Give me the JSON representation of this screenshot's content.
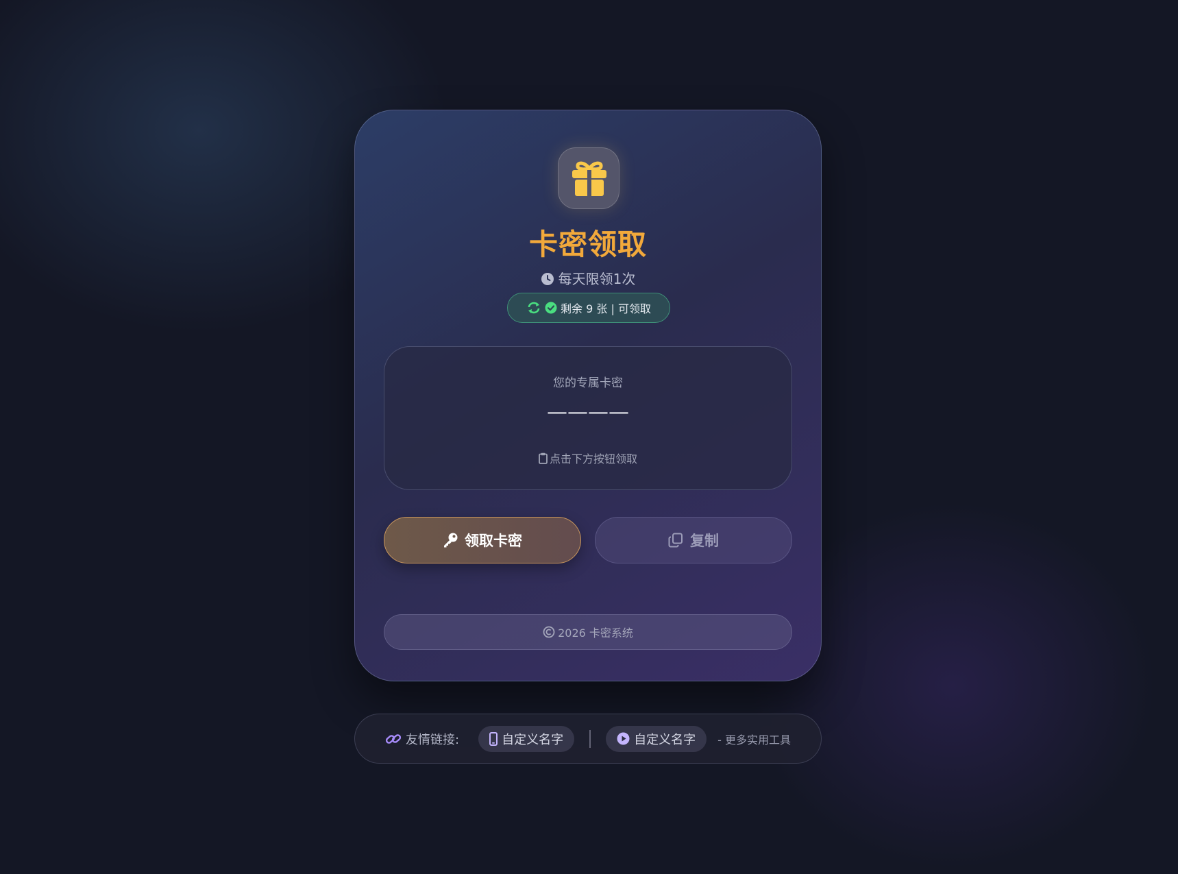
{
  "card": {
    "icon": "gift-icon",
    "title": "卡密领取",
    "subtitle": "每天限领1次",
    "badge": {
      "text": "剩余 9 张 | 可领取",
      "icons": [
        "refresh-icon",
        "check-circle-icon"
      ]
    },
    "key_panel": {
      "label": "您的专属卡密",
      "value": "————",
      "hint": "点击下方按钮领取"
    },
    "buttons": {
      "claim": "领取卡密",
      "copy": "复制"
    },
    "footer": "2026 卡密系统"
  },
  "links": {
    "title": "友情链接:",
    "items": [
      {
        "label": "自定义名字",
        "icon": "mobile-icon"
      },
      {
        "label": "自定义名字",
        "icon": "play-circle-icon"
      }
    ],
    "more": "- 更多实用工具"
  },
  "colors": {
    "accent": "#f2a93b",
    "success": "#4ade80",
    "background": "#141725"
  }
}
